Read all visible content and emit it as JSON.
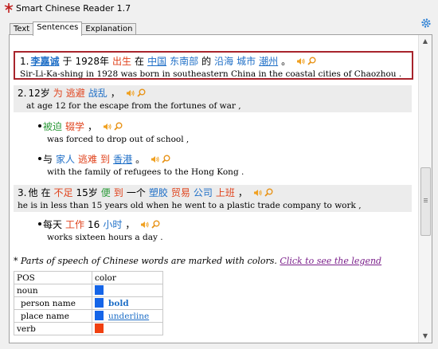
{
  "window": {
    "title": "Smart Chinese Reader 1.7"
  },
  "tabs": [
    {
      "label": "Text"
    },
    {
      "label": "Sentences"
    },
    {
      "label": "Explanation"
    }
  ],
  "sentences": {
    "s1": {
      "num": "1.",
      "words": {
        "w1": "李嘉诚",
        "w2": "于",
        "w3": "1928年",
        "w4": "出生",
        "w5": "在",
        "w6": "中国",
        "w7": "东南部",
        "w8": "的",
        "w9": "沿海",
        "w10": "城市",
        "w11": "潮州",
        "w12": "。"
      },
      "english": "Sir-Li-Ka-shing in 1928 was born in southeastern China in the coastal cities of Chaozhou ."
    },
    "s2": {
      "num": "2.",
      "words": {
        "w1": "12岁",
        "w2": "为",
        "w3": "逃避",
        "w4": "战乱",
        "w5": "，"
      },
      "english": "at age 12 for the escape from the fortunes of war ,"
    },
    "s2a": {
      "words": {
        "w1": "被迫",
        "w2": "辍学",
        "w3": "，"
      },
      "english": "was forced to drop out of school ,"
    },
    "s2b": {
      "words": {
        "w1": "与",
        "w2": "家人",
        "w3": "逃难",
        "w4": "到",
        "w5": "香港",
        "w6": "。"
      },
      "english": "with the family of refugees to the Hong Kong ."
    },
    "s3": {
      "num": "3.",
      "words": {
        "w1": "他",
        "w2": "在",
        "w3": "不足",
        "w4": "15岁",
        "w5": "便",
        "w6": "到",
        "w7": "一个",
        "w8": "塑胶",
        "w9": "贸易",
        "w10": "公司",
        "w11": "上班",
        "w12": "，"
      },
      "english": "he is in less than 15 years old when he went to a plastic trade company to work ,"
    },
    "s3a": {
      "words": {
        "w1": "每天",
        "w2": "工作",
        "w3": "16",
        "w4": "小时",
        "w5": "，"
      },
      "english": "works sixteen hours a day ."
    }
  },
  "note": {
    "text": "* Parts of speech of Chinese words are marked with colors.",
    "link": "Click to see the legend"
  },
  "legend": {
    "headers": {
      "pos": "POS",
      "color": "color"
    },
    "rows": [
      {
        "pos": "noun",
        "color_hex": "#1565e8",
        "style": ""
      },
      {
        "pos": "person name",
        "color_hex": "#1565e8",
        "style": "bold"
      },
      {
        "pos": "place name",
        "color_hex": "#1565e8",
        "style": "underline"
      },
      {
        "pos": "verb",
        "color_hex": "#f04010",
        "style": ""
      }
    ]
  },
  "colors": {
    "verb": "#e0431d",
    "noun": "#1f6fc7",
    "adjective": "#2d9a3a",
    "highlight_border": "#a8242c"
  },
  "icons": {
    "speaker": "speaker-icon",
    "search": "magnifier-icon",
    "settings": "gear-icon",
    "app": "app-icon"
  }
}
